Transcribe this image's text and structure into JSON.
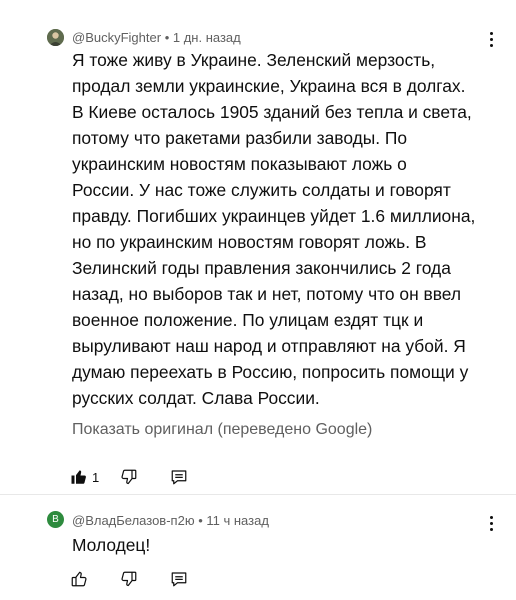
{
  "comments": [
    {
      "author": "@BuckyFighter",
      "separator": "•",
      "time": "1 дн. назад",
      "avatar_color": "#6b7a57",
      "lines": [
        "Я тоже живу в Украине. Зеленский мерзость,",
        "продал земли украинские, Украина вся в долгах.",
        "В Киеве осталось 1905 зданий без тепла и света,",
        "потому что ракетами разбили заводы. По",
        "украинским новостям показывают ложь о",
        "России. У нас тоже служить солдаты и говорят",
        "правду. Погибших украинцев уйдет 1.6 миллиона,",
        "но по украинским новостям говорят ложь. В",
        "Зелинский годы правления закончились 2 года",
        "назад, но выборов так и нет, потому что он ввел",
        "военное положение. По улицам ездят тцк и",
        "выруливают наш народ и отправляют на убой. Я",
        "думаю переехать в Россию, попросить помощи у",
        "русских солдат. Слава России."
      ],
      "translation_note": "Показать оригинал (переведено Google)",
      "like_count": "1",
      "like_icon": "thumbs-up-filled-icon",
      "dislike_icon": "thumbs-down-icon",
      "reply_icon": "reply-comment-icon"
    },
    {
      "author": "@ВладБелазов-п2ю",
      "separator": "•",
      "time": "11 ч назад",
      "avatar_letter": "В",
      "avatar_color": "#2e8b3e",
      "text": "Молодец!",
      "like_icon": "thumbs-up-icon",
      "dislike_icon": "thumbs-down-icon",
      "reply_icon": "reply-comment-icon"
    }
  ]
}
